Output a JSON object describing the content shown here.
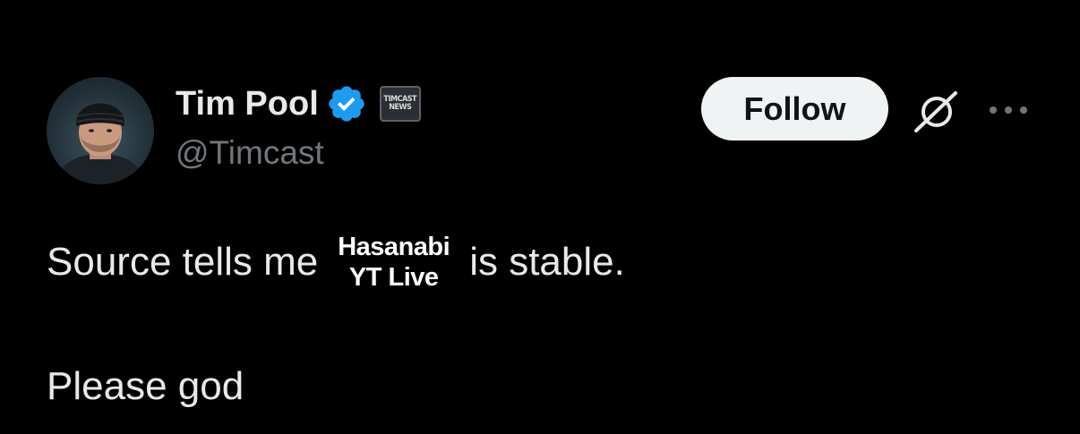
{
  "user": {
    "display_name": "Tim Pool",
    "handle": "@Timcast",
    "verified": true,
    "affiliation_badge": {
      "line1": "TIMCAST",
      "line2": "NEWS"
    }
  },
  "actions": {
    "follow_label": "Follow",
    "grok_icon": "grok-icon",
    "more_icon": "more-dots-icon"
  },
  "tweet": {
    "text_before": "Source tells me",
    "overlay_line1": "Hasanabi",
    "overlay_line2": "YT Live",
    "text_after": "is stable.",
    "second_paragraph": "Please god"
  },
  "colors": {
    "background": "#000000",
    "primary_text": "#e7e9ea",
    "secondary_text": "#71767b",
    "verified_blue": "#1d9bf0",
    "follow_button_bg": "#eff3f4"
  }
}
